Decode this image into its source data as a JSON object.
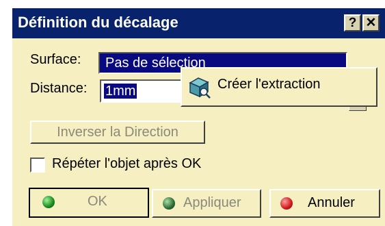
{
  "window": {
    "title": "Définition du décalage",
    "help_label": "?",
    "close_label": "✕"
  },
  "form": {
    "surface_label": "Surface:",
    "surface_value": "Pas de sélection",
    "distance_label": "Distance:",
    "distance_value": "1mm"
  },
  "context_menu": {
    "item_label": "Créer l'extraction",
    "item_icon": "extract-icon"
  },
  "inverse_button": "Inverser la Direction",
  "repeat_checkbox": {
    "label": "Répéter l'objet après OK",
    "checked": false
  },
  "buttons": {
    "ok": "OK",
    "apply": "Appliquer",
    "cancel": "Annuler"
  },
  "colors": {
    "title_bg": "#08236b",
    "dialog_bg": "#f5efc2",
    "ok_dot": "#1a8a1a",
    "apply_dot": "#2b6b33",
    "cancel_dot": "#d01818"
  }
}
